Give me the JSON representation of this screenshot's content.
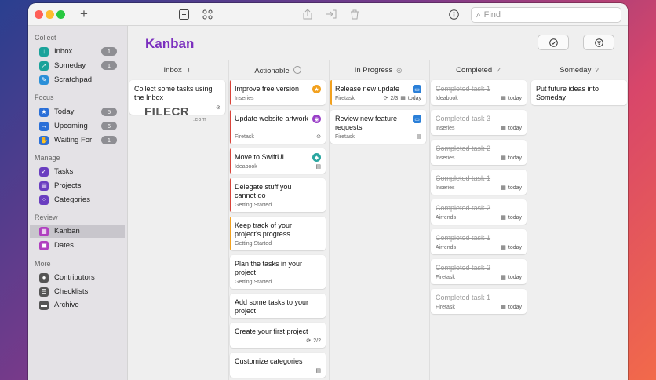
{
  "toolbar": {
    "add_icon": "plus-icon",
    "search_placeholder": "Find"
  },
  "sidebar": {
    "sections": [
      {
        "title": "Collect"
      },
      {
        "title": "Focus"
      },
      {
        "title": "Manage"
      },
      {
        "title": "Review"
      },
      {
        "title": "More"
      }
    ],
    "items": [
      {
        "label": "Inbox",
        "badge": "1",
        "icon": "inbox-icon",
        "color": "#1aa29a"
      },
      {
        "label": "Someday",
        "badge": "1",
        "icon": "someday-icon",
        "color": "#1aa29a"
      },
      {
        "label": "Scratchpad",
        "badge": "",
        "icon": "scratchpad-icon",
        "color": "#2a8fd8"
      },
      {
        "label": "Today",
        "badge": "5",
        "icon": "star-icon",
        "color": "#2a6fd8"
      },
      {
        "label": "Upcoming",
        "badge": "6",
        "icon": "upcoming-icon",
        "color": "#2a6fd8"
      },
      {
        "label": "Waiting For",
        "badge": "1",
        "icon": "waiting-icon",
        "color": "#2a6fd8"
      },
      {
        "label": "Tasks",
        "badge": "",
        "icon": "checkbox-icon",
        "color": "#6a3ec0"
      },
      {
        "label": "Projects",
        "badge": "",
        "icon": "projects-icon",
        "color": "#6a3ec0"
      },
      {
        "label": "Categories",
        "badge": "",
        "icon": "categories-icon",
        "color": "#6a3ec0"
      },
      {
        "label": "Kanban",
        "badge": "",
        "icon": "kanban-icon",
        "color": "#b040c0"
      },
      {
        "label": "Dates",
        "badge": "",
        "icon": "dates-icon",
        "color": "#b040c0"
      },
      {
        "label": "Contributors",
        "badge": "",
        "icon": "contributors-icon",
        "color": "#555"
      },
      {
        "label": "Checklists",
        "badge": "",
        "icon": "checklists-icon",
        "color": "#555"
      },
      {
        "label": "Archive",
        "badge": "",
        "icon": "archive-icon",
        "color": "#555"
      }
    ]
  },
  "main": {
    "title": "Kanban",
    "columns": [
      {
        "title": "Inbox"
      },
      {
        "title": "Actionable"
      },
      {
        "title": "In Progress"
      },
      {
        "title": "Completed"
      },
      {
        "title": "Someday"
      }
    ],
    "inbox": [
      {
        "title": "Collect some tasks using the Inbox"
      }
    ],
    "actionable": [
      {
        "title": "Improve free version",
        "project": "Inseries"
      },
      {
        "title": "Update website artwork",
        "project": "Firetask"
      },
      {
        "title": "Move to SwiftUI",
        "project": "Ideabook"
      },
      {
        "title": "Delegate stuff you cannot do",
        "project": "Getting Started"
      },
      {
        "title": "Keep track of your project's progress",
        "project": "Getting Started"
      },
      {
        "title": "Plan the tasks in your project",
        "project": "Getting Started"
      },
      {
        "title": "Add some tasks to your project",
        "project": ""
      },
      {
        "title": "Create your first project",
        "project": "",
        "meta": "2/2"
      },
      {
        "title": "Customize categories",
        "project": ""
      }
    ],
    "in_progress": [
      {
        "title": "Release new update",
        "project": "Firetask",
        "meta": "2/3",
        "date": "today"
      },
      {
        "title": "Review new feature requests",
        "project": "Firetask"
      }
    ],
    "completed": [
      {
        "title": "Completed task 1",
        "project": "Ideabook",
        "date": "today"
      },
      {
        "title": "Completed task 3",
        "project": "Inseries",
        "date": "today"
      },
      {
        "title": "Completed task 2",
        "project": "Inseries",
        "date": "today"
      },
      {
        "title": "Completed task 1",
        "project": "Inseries",
        "date": "today"
      },
      {
        "title": "Completed task 2",
        "project": "Airrends",
        "date": "today"
      },
      {
        "title": "Completed task 1",
        "project": "Airrends",
        "date": "today"
      },
      {
        "title": "Completed task 2",
        "project": "Firetask",
        "date": "today"
      },
      {
        "title": "Completed task 1",
        "project": "Firetask",
        "date": "today"
      }
    ],
    "someday": [
      {
        "title": "Put future ideas into Someday"
      }
    ]
  },
  "watermark": {
    "text": "FILECR",
    "sub": ".com"
  }
}
